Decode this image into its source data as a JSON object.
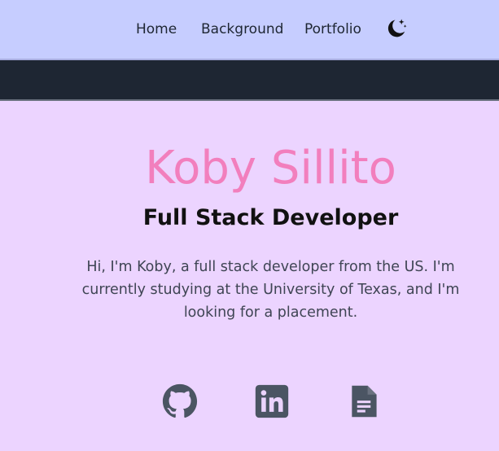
{
  "nav": {
    "items": [
      {
        "label": "Home"
      },
      {
        "label": "Background"
      },
      {
        "label": "Portfolio"
      }
    ],
    "theme_toggle_icon": "moon-stars-icon"
  },
  "hero": {
    "name": "Koby Sillito",
    "role": "Full Stack Developer",
    "intro": "Hi, I'm Koby, a full stack developer from the US. I'm currently studying at the University of Texas, and I'm looking for a placement."
  },
  "social": {
    "icons": [
      "github-icon",
      "linkedin-icon",
      "document-icon"
    ],
    "icon_color": "#4b5563"
  },
  "colors": {
    "nav_bg": "#c6cdff",
    "dark_bar": "#1e2633",
    "page_bg": "#ecd4ff",
    "accent": "#f27fbd"
  }
}
